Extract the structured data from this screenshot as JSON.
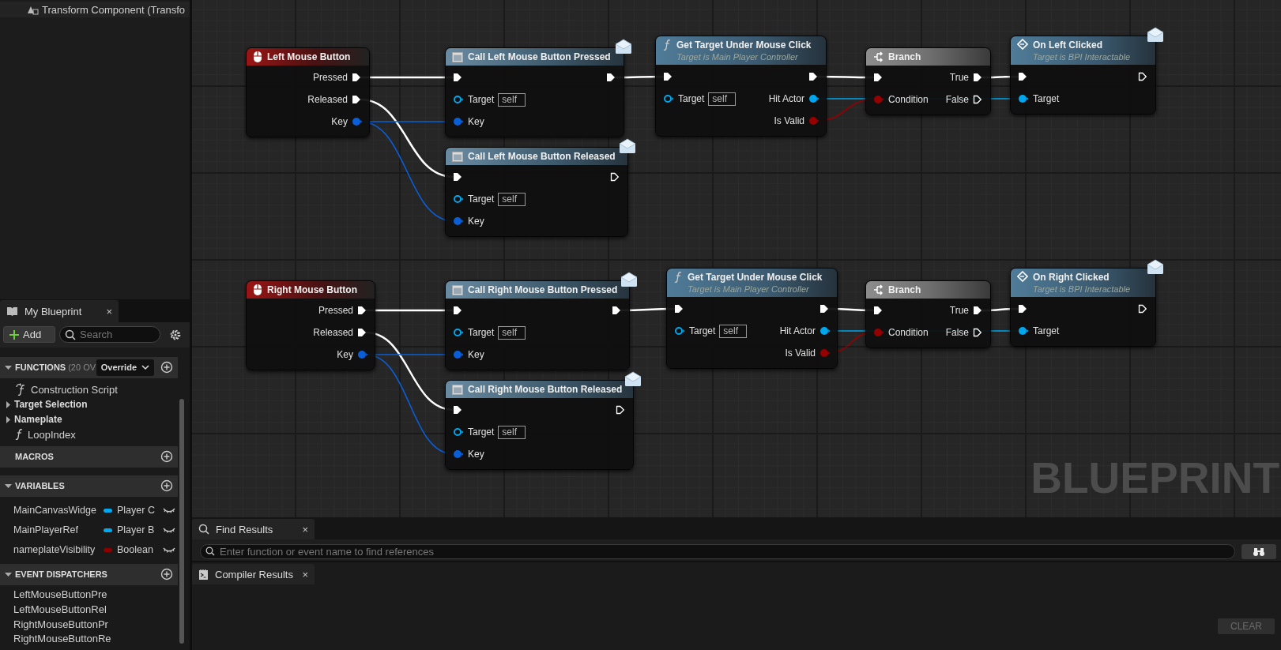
{
  "details_tree": {
    "items": [
      {
        "label": "Transform Component (Transfo"
      }
    ]
  },
  "my_blueprint": {
    "tab": {
      "title": "My Blueprint",
      "close": "×"
    },
    "add_button": {
      "label": "Add"
    },
    "search": {
      "placeholder": "Search"
    },
    "sections": [
      {
        "kind": "functions",
        "title": "FUNCTIONS",
        "note": "(20 OV",
        "dropdown": "Override",
        "expanded": true,
        "items": [
          {
            "kind": "script",
            "label": "Construction Script"
          },
          {
            "kind": "category",
            "label": "Target Selection",
            "expanded": false
          },
          {
            "kind": "category",
            "label": "Nameplate",
            "expanded": false
          },
          {
            "kind": "function",
            "label": "LoopIndex"
          }
        ]
      },
      {
        "kind": "macros",
        "title": "MACROS"
      },
      {
        "kind": "variables",
        "title": "VARIABLES",
        "expanded": true,
        "items": [
          {
            "kind": "variable",
            "label": "MainCanvasWidge",
            "type": "Player C",
            "color": "#00a8f0"
          },
          {
            "kind": "variable",
            "label": "MainPlayerRef",
            "type": "Player B",
            "color": "#00a8f0"
          },
          {
            "kind": "variable",
            "label": "nameplateVisibility",
            "type": "Boolean",
            "color": "#8c0000"
          }
        ]
      },
      {
        "kind": "dispatchers",
        "title": "EVENT DISPATCHERS",
        "expanded": true,
        "items": [
          {
            "kind": "dispatcher",
            "label": "LeftMouseButtonPre"
          },
          {
            "kind": "dispatcher",
            "label": "LeftMouseButtonRel"
          },
          {
            "kind": "dispatcher",
            "label": "RightMouseButtonPr"
          },
          {
            "kind": "dispatcher",
            "label": "RightMouseButtonRe"
          }
        ]
      }
    ]
  },
  "graph": {
    "nodes": [
      {
        "kind": "event",
        "title": "Left Mouse Button",
        "rows": [
          {
            "right": {
              "label": "Pressed",
              "kind": "exec",
              "connected": true
            }
          },
          {
            "right": {
              "label": "Released",
              "kind": "exec",
              "connected": true
            }
          },
          {
            "right": {
              "label": "Key",
              "kind": "struct",
              "connected": true
            }
          }
        ]
      },
      {
        "kind": "call",
        "title": "Call Left Mouse Button Pressed",
        "rows": [
          {
            "left": {
              "kind": "exec",
              "connected": true
            },
            "right": {
              "kind": "exec",
              "connected": true
            }
          },
          {
            "left": {
              "label": "Target",
              "kind": "object",
              "value": "self",
              "connected": false
            }
          },
          {
            "left": {
              "label": "Key",
              "kind": "struct",
              "connected": true
            }
          }
        ]
      },
      {
        "kind": "call",
        "title": "Call Left Mouse Button Released",
        "rows": [
          {
            "left": {
              "kind": "exec",
              "connected": true
            },
            "right": {
              "kind": "exec",
              "connected": false
            }
          },
          {
            "left": {
              "label": "Target",
              "kind": "object",
              "value": "self",
              "connected": false
            }
          },
          {
            "left": {
              "label": "Key",
              "kind": "struct",
              "connected": true
            }
          }
        ]
      },
      {
        "kind": "function",
        "title": "Get Target Under Mouse Click",
        "subtitle": "Target is Main Player Controller",
        "rows": [
          {
            "left": {
              "kind": "exec",
              "connected": true
            },
            "right": {
              "kind": "exec",
              "connected": true
            }
          },
          {
            "left": {
              "label": "Target",
              "kind": "object",
              "value": "self",
              "connected": false
            },
            "right": {
              "label": "Hit Actor",
              "kind": "object",
              "connected": true
            }
          },
          {
            "right": {
              "label": "Is Valid",
              "kind": "bool",
              "connected": true
            }
          }
        ]
      },
      {
        "kind": "branch",
        "title": "Branch",
        "rows": [
          {
            "left": {
              "kind": "exec",
              "connected": true
            },
            "right": {
              "label": "True",
              "kind": "exec",
              "connected": true
            }
          },
          {
            "left": {
              "label": "Condition",
              "kind": "bool",
              "connected": true
            },
            "right": {
              "label": "False",
              "kind": "exec",
              "connected": false
            }
          }
        ]
      },
      {
        "kind": "message",
        "title": "On Left Clicked",
        "subtitle": "Target is BPI Interactable",
        "rows": [
          {
            "left": {
              "kind": "exec",
              "connected": true
            },
            "right": {
              "kind": "exec",
              "connected": false
            }
          },
          {
            "left": {
              "label": "Target",
              "kind": "object",
              "connected": true
            }
          }
        ]
      },
      {
        "kind": "event",
        "title": "Right Mouse Button",
        "rows": [
          {
            "right": {
              "label": "Pressed",
              "kind": "exec",
              "connected": true
            }
          },
          {
            "right": {
              "label": "Released",
              "kind": "exec",
              "connected": true
            }
          },
          {
            "right": {
              "label": "Key",
              "kind": "struct",
              "connected": true
            }
          }
        ]
      },
      {
        "kind": "call",
        "title": "Call Right Mouse Button Pressed",
        "rows": [
          {
            "left": {
              "kind": "exec",
              "connected": true
            },
            "right": {
              "kind": "exec",
              "connected": true
            }
          },
          {
            "left": {
              "label": "Target",
              "kind": "object",
              "value": "self",
              "connected": false
            }
          },
          {
            "left": {
              "label": "Key",
              "kind": "struct",
              "connected": true
            }
          }
        ]
      },
      {
        "kind": "call",
        "title": "Call Right Mouse Button Released",
        "rows": [
          {
            "left": {
              "kind": "exec",
              "connected": true
            },
            "right": {
              "kind": "exec",
              "connected": false
            }
          },
          {
            "left": {
              "label": "Target",
              "kind": "object",
              "value": "self",
              "connected": false
            }
          },
          {
            "left": {
              "label": "Key",
              "kind": "struct",
              "connected": true
            }
          }
        ]
      },
      {
        "kind": "function",
        "title": "Get Target Under Mouse Click",
        "subtitle": "Target is Main Player Controller",
        "rows": [
          {
            "left": {
              "kind": "exec",
              "connected": true
            },
            "right": {
              "kind": "exec",
              "connected": true
            }
          },
          {
            "left": {
              "label": "Target",
              "kind": "object",
              "value": "self",
              "connected": false
            },
            "right": {
              "label": "Hit Actor",
              "kind": "object",
              "connected": true
            }
          },
          {
            "right": {
              "label": "Is Valid",
              "kind": "bool",
              "connected": true
            }
          }
        ]
      },
      {
        "kind": "branch",
        "title": "Branch",
        "rows": [
          {
            "left": {
              "kind": "exec",
              "connected": true
            },
            "right": {
              "label": "True",
              "kind": "exec",
              "connected": true
            }
          },
          {
            "left": {
              "label": "Condition",
              "kind": "bool",
              "connected": true
            },
            "right": {
              "label": "False",
              "kind": "exec",
              "connected": false
            }
          }
        ]
      },
      {
        "kind": "message",
        "title": "On Right Clicked",
        "subtitle": "Target is BPI Interactable",
        "rows": [
          {
            "left": {
              "kind": "exec",
              "connected": true
            },
            "right": {
              "kind": "exec",
              "connected": false
            }
          },
          {
            "left": {
              "label": "Target",
              "kind": "object",
              "connected": true
            }
          }
        ]
      }
    ],
    "watermark": "BLUEPRINT"
  },
  "find_results": {
    "tab": {
      "title": "Find Results",
      "close": "×"
    },
    "search": {
      "placeholder": "Enter function or event name to find references"
    }
  },
  "compiler_results": {
    "tab": {
      "title": "Compiler Results",
      "close": "×"
    },
    "clear_button": {
      "label": "CLEAR",
      "disabled": true
    }
  }
}
